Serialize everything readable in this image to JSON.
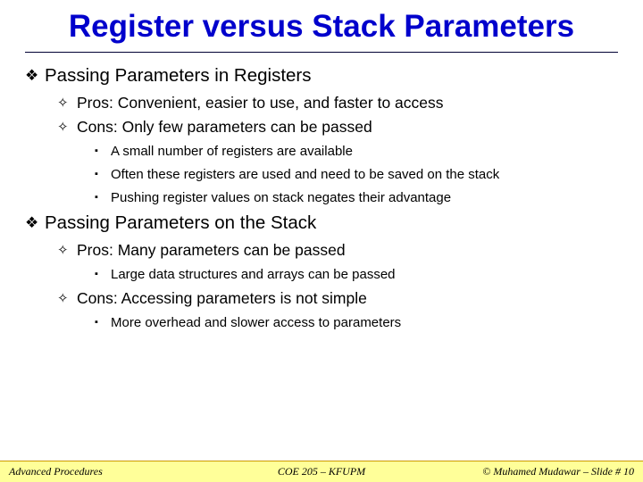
{
  "title": "Register versus Stack Parameters",
  "sections": [
    {
      "heading": "Passing Parameters in Registers",
      "items": [
        {
          "text": "Pros: Convenient, easier to use, and faster to access",
          "sub": []
        },
        {
          "text": "Cons: Only few parameters can be passed",
          "sub": [
            "A small number of registers are available",
            "Often these registers are used and need to be saved on the stack",
            "Pushing register values on stack negates their advantage"
          ]
        }
      ]
    },
    {
      "heading": "Passing Parameters on the Stack",
      "items": [
        {
          "text": "Pros: Many parameters can be passed",
          "sub": [
            "Large data structures and arrays can be passed"
          ]
        },
        {
          "text": "Cons: Accessing parameters is not simple",
          "sub": [
            "More overhead and slower access to parameters"
          ]
        }
      ]
    }
  ],
  "footer": {
    "left": "Advanced Procedures",
    "center": "COE 205 – KFUPM",
    "right_author": "© Muhamed Mudawar",
    "right_sep": " – ",
    "right_slide": "Slide # 10"
  },
  "bullets": {
    "l1": "❖",
    "l2": "✧",
    "l3": "▪"
  }
}
